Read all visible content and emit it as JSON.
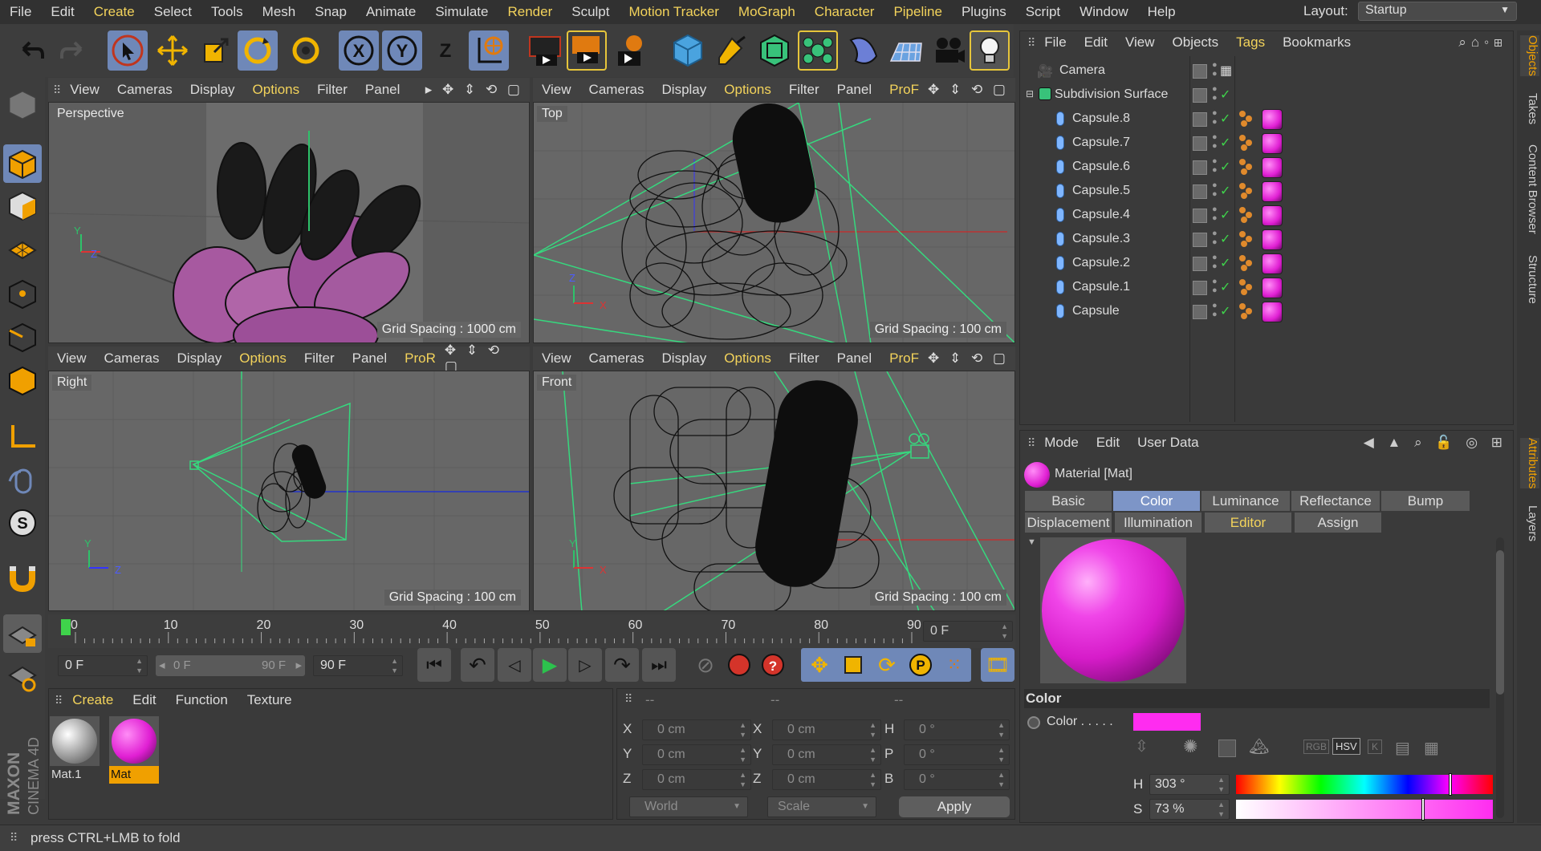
{
  "menu": [
    "File",
    "Edit",
    "Create",
    "Select",
    "Tools",
    "Mesh",
    "Snap",
    "Animate",
    "Simulate",
    "Render",
    "Sculpt",
    "Motion Tracker",
    "MoGraph",
    "Character",
    "Pipeline",
    "Plugins",
    "Script",
    "Window",
    "Help"
  ],
  "menu_highlight": [
    "Create",
    "Render",
    "Motion Tracker",
    "MoGraph",
    "Character",
    "Pipeline"
  ],
  "layout_label": "Layout:",
  "layout_value": "Startup",
  "toolbar_letters": {
    "x": "X",
    "y": "Y",
    "z": "Z"
  },
  "viewport_menu": [
    "View",
    "Cameras",
    "Display",
    "Options",
    "Filter",
    "Panel"
  ],
  "viewports": {
    "perspective": {
      "label": "Perspective",
      "grid": "Grid Spacing : 1000 cm",
      "extra": ""
    },
    "top": {
      "label": "Top",
      "grid": "Grid Spacing : 100 cm",
      "extra": "ProF"
    },
    "right": {
      "label": "Right",
      "grid": "Grid Spacing : 100 cm",
      "extra": "ProR"
    },
    "front": {
      "label": "Front",
      "grid": "Grid Spacing : 100 cm",
      "extra": "ProF"
    }
  },
  "axes": {
    "x": "X",
    "y": "Y",
    "z": "Z"
  },
  "object_manager": {
    "menu": [
      "File",
      "Edit",
      "View",
      "Objects",
      "Tags",
      "Bookmarks"
    ],
    "objects": [
      "Camera",
      "Subdivision Surface",
      "Capsule.8",
      "Capsule.7",
      "Capsule.6",
      "Capsule.5",
      "Capsule.4",
      "Capsule.3",
      "Capsule.2",
      "Capsule.1",
      "Capsule"
    ]
  },
  "side_tabs_top": [
    "Objects",
    "Takes",
    "Content Browser",
    "Structure"
  ],
  "side_tabs_bottom": [
    "Attributes",
    "Layers"
  ],
  "timeline": {
    "ticks": [
      "0",
      "10",
      "20",
      "30",
      "40",
      "50",
      "60",
      "70",
      "80",
      "90"
    ],
    "current": "0 F",
    "start": "0 F",
    "range_start": "0 F",
    "range_end": "90 F",
    "end": "90 F"
  },
  "material_manager": {
    "menu": [
      "Create",
      "Edit",
      "Function",
      "Texture"
    ],
    "materials": [
      {
        "name": "Mat.1",
        "selected": false
      },
      {
        "name": "Mat",
        "selected": true
      }
    ]
  },
  "coordinates": {
    "headers": [
      "--",
      "--",
      "--"
    ],
    "rows": [
      {
        "a": "X",
        "av": "0 cm",
        "b": "X",
        "bv": "0 cm",
        "c": "H",
        "cv": "0 °"
      },
      {
        "a": "Y",
        "av": "0 cm",
        "b": "Y",
        "bv": "0 cm",
        "c": "P",
        "cv": "0 °"
      },
      {
        "a": "Z",
        "av": "0 cm",
        "b": "Z",
        "bv": "0 cm",
        "c": "B",
        "cv": "0 °"
      }
    ],
    "mode1": "World",
    "mode2": "Scale",
    "apply": "Apply"
  },
  "attributes": {
    "menu": [
      "Mode",
      "Edit",
      "User Data"
    ],
    "title": "Material [Mat]",
    "tabs_row1": [
      "Basic",
      "Color",
      "Luminance",
      "Reflectance",
      "Bump"
    ],
    "tabs_row2": [
      "Displacement",
      "Illumination",
      "Editor",
      "Assign"
    ],
    "active_tab": "Color",
    "section": "Color",
    "color_label": "Color . . . . .",
    "color_swatch": "#ff2cf0",
    "mode_buttons": [
      "RGB",
      "HSV",
      "K"
    ],
    "h_label": "H",
    "h_value": "303 °",
    "h_fraction": 0.84,
    "s_label": "S",
    "s_value": "73 %",
    "s_fraction": 0.73
  },
  "status": "press CTRL+LMB to fold",
  "logo": "MAXON CINEMA 4D"
}
